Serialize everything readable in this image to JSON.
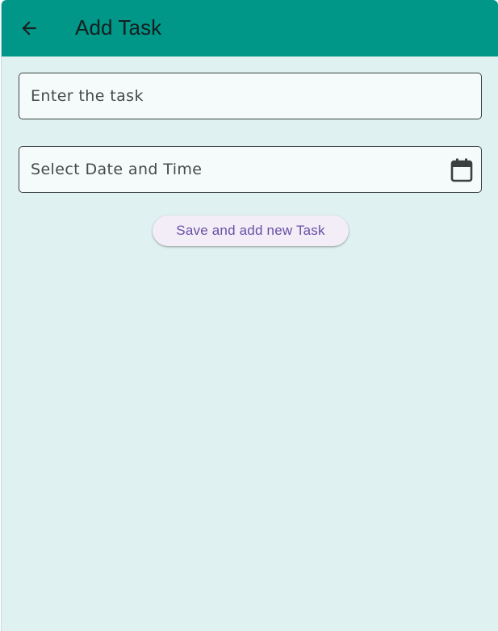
{
  "appbar": {
    "title": "Add Task",
    "back_icon": "arrow-left-icon",
    "background_color": "#009688"
  },
  "form": {
    "task_input": {
      "placeholder": "Enter the task",
      "value": ""
    },
    "date_input": {
      "placeholder": "Select Date and Time",
      "value": "",
      "icon": "calendar-icon"
    },
    "save_button": {
      "label": "Save and add new Task",
      "text_color": "#6750a4"
    }
  },
  "page_background_color": "#dff1f0"
}
